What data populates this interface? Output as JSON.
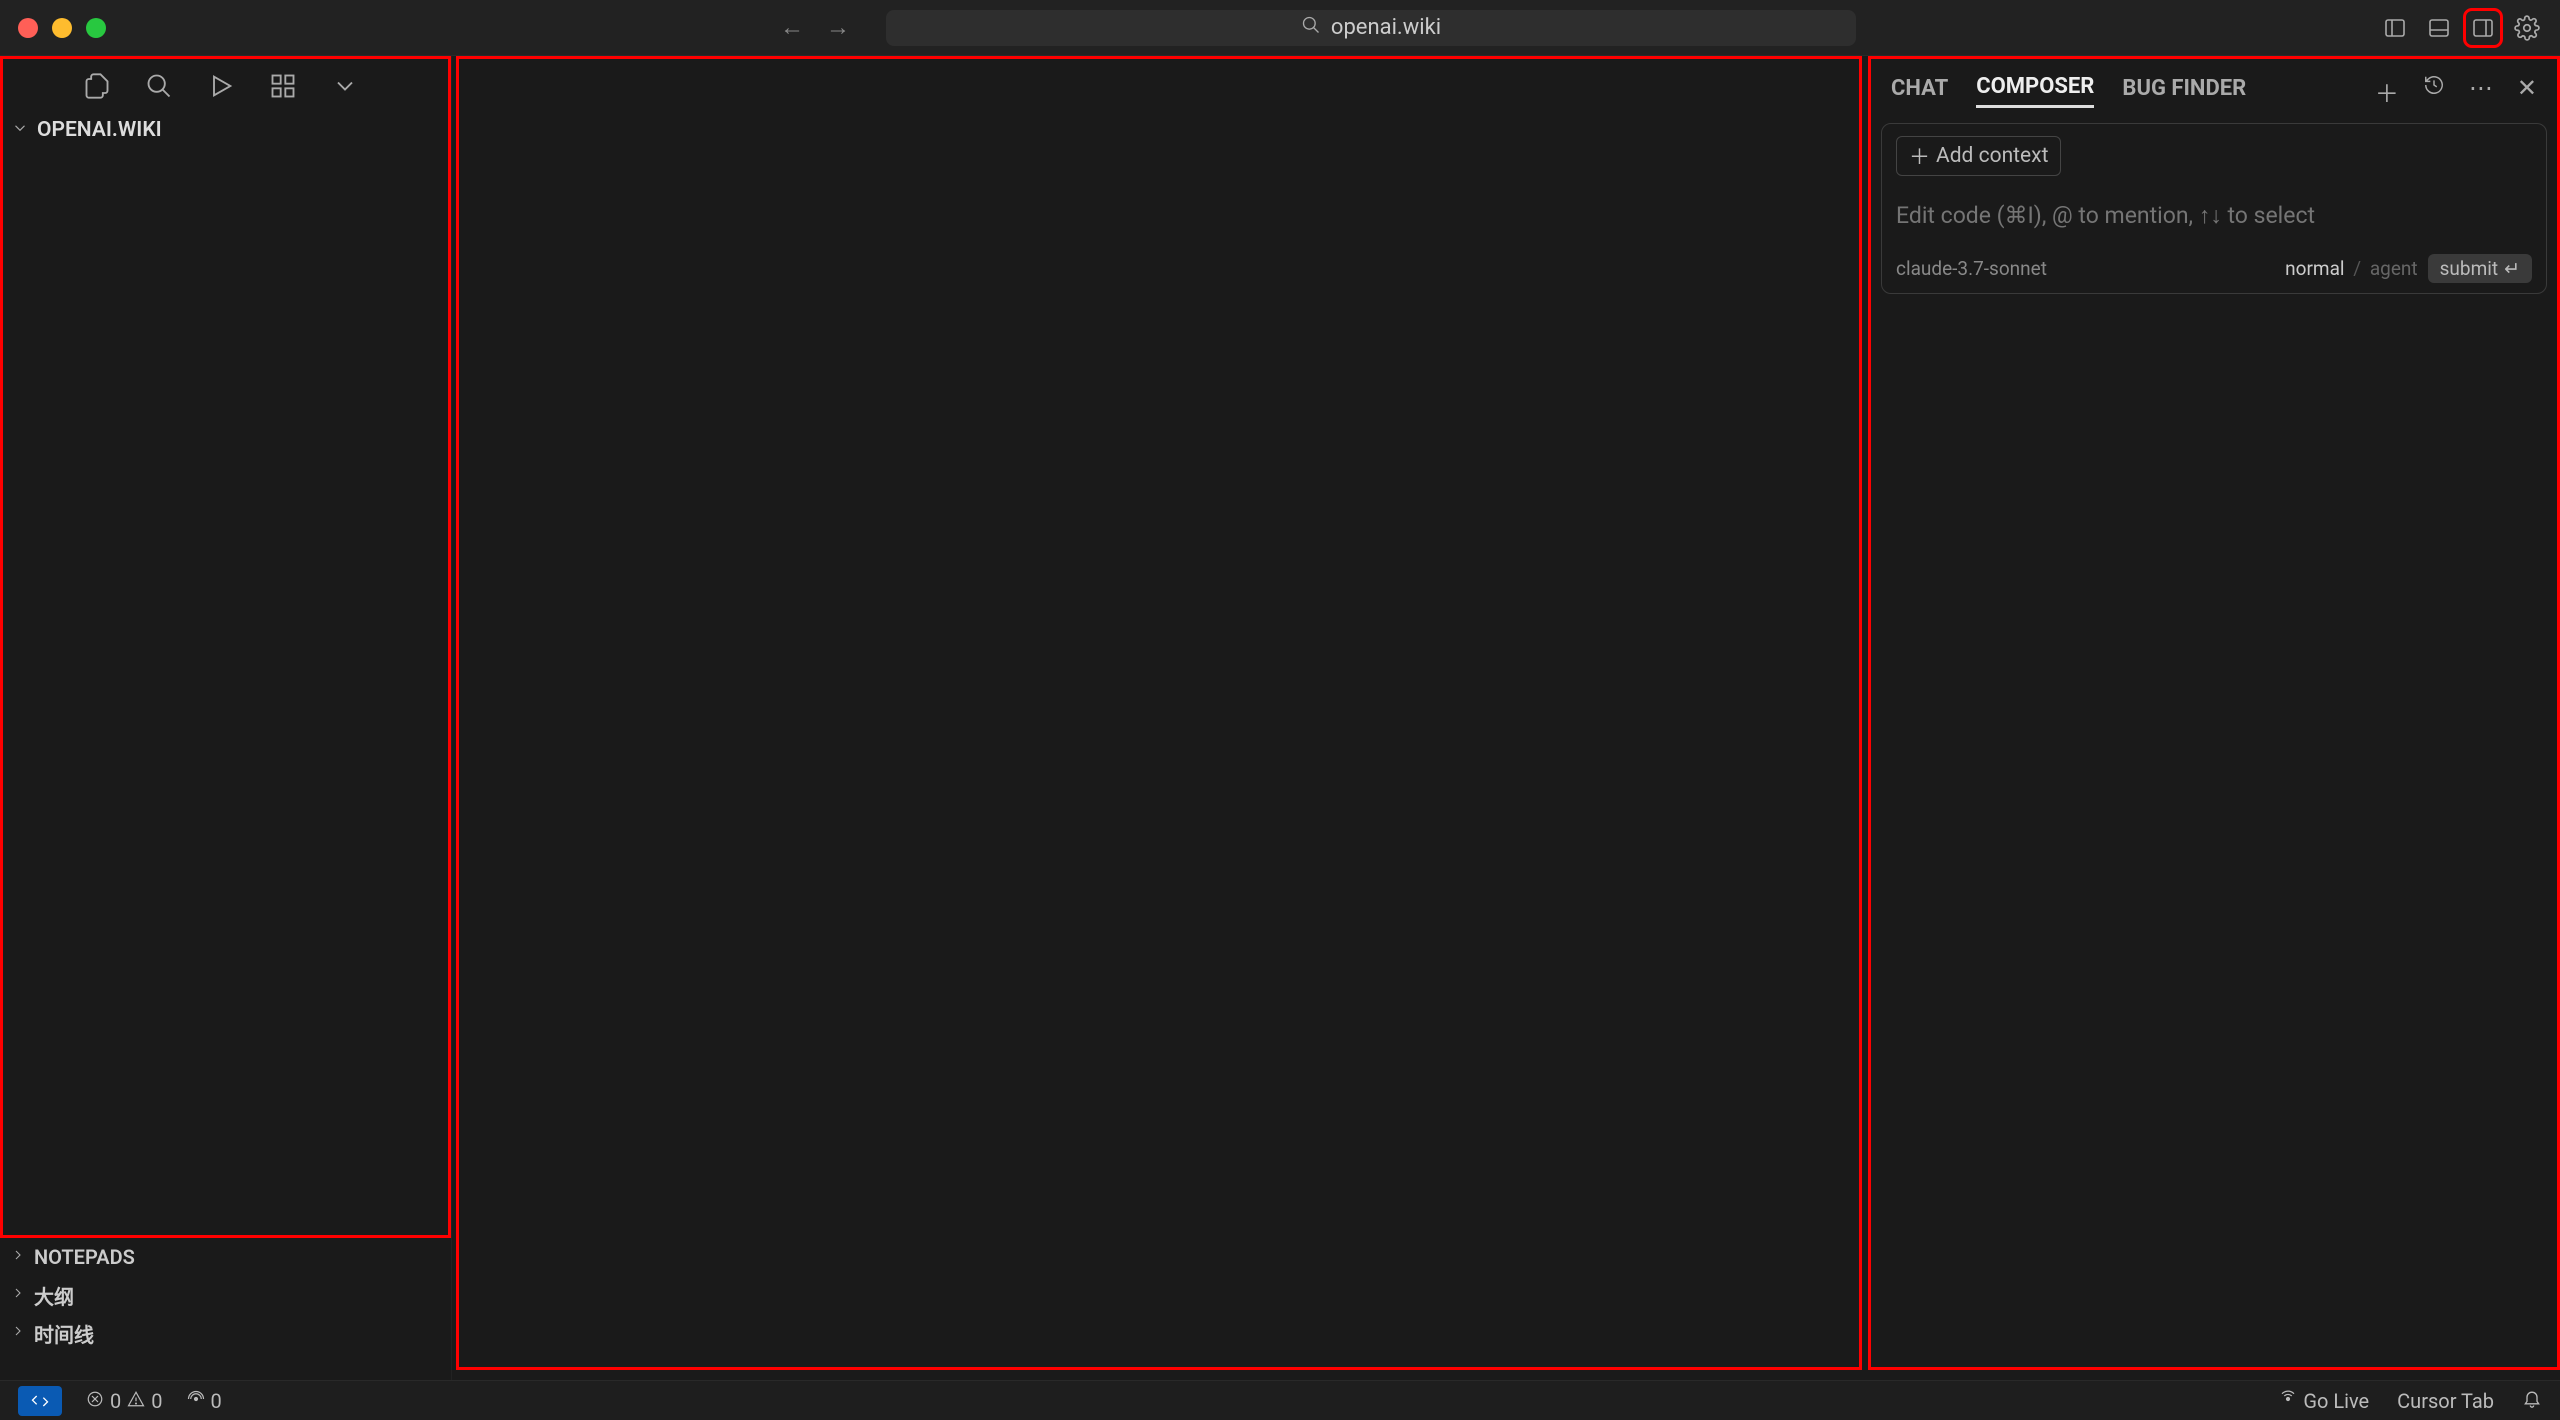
{
  "titlebar": {
    "url": "openai.wiki"
  },
  "sidebar": {
    "explorer_title": "OPENAI.WIKI",
    "sections": [
      {
        "label": "NOTEPADS"
      },
      {
        "label": "大纲"
      },
      {
        "label": "时间线"
      }
    ]
  },
  "right_panel": {
    "tabs": [
      {
        "label": "CHAT",
        "active": false
      },
      {
        "label": "COMPOSER",
        "active": true
      },
      {
        "label": "BUG FINDER",
        "active": false
      }
    ],
    "composer": {
      "add_context_label": "Add context",
      "input_placeholder": "Edit code (⌘I), @ to mention, ↑↓ to select",
      "model": "claude-3.7-sonnet",
      "mode_normal": "normal",
      "mode_agent": "agent",
      "submit_label": "submit"
    }
  },
  "statusbar": {
    "errors": "0",
    "warnings": "0",
    "ports": "0",
    "go_live": "Go Live",
    "cursor_tab": "Cursor Tab"
  }
}
